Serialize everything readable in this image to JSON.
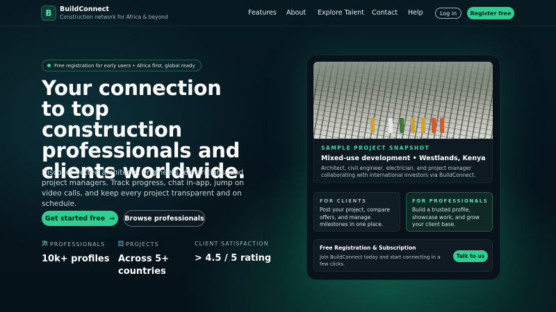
{
  "brand": {
    "logo_letter": "B",
    "name": "BuildConnect",
    "tagline": "Construction network for Africa & beyond"
  },
  "nav": {
    "links": [
      "Features",
      "About",
      "Explore Talent",
      "Contact",
      "Help"
    ],
    "login": "Log in",
    "register": "Register free"
  },
  "hero": {
    "badge": "Free registration for early users • Africa first, global ready",
    "headline": "Your connection to top construction professionals and clients worldwide.",
    "subtext": "Discover vetted architects, engineers, electricians, and project managers. Track progress, chat in-app, jump on video calls, and keep every project transparent and on schedule.",
    "cta_primary": "Get started free",
    "cta_primary_arrow": "→",
    "cta_secondary": "Browse professionals"
  },
  "stats": [
    {
      "label": "PROFESSIONALS",
      "value": "10k+ profiles",
      "icon": "users-icon"
    },
    {
      "label": "PROJECTS",
      "value": "Across 5+ countries",
      "icon": "building-icon"
    },
    {
      "label": "CLIENT SATISFACTION",
      "value": "> 4.5 / 5 rating",
      "icon": ""
    }
  ],
  "snapshot": {
    "kicker": "SAMPLE PROJECT SNAPSHOT",
    "title": "Mixed-use development • Westlands, Kenya",
    "description": "Architect, civil engineer, electrician, and project manager collaborating with international investors via BuildConnect."
  },
  "cards": {
    "clients": {
      "kicker": "FOR CLIENTS",
      "text": "Post your project, compare offers, and manage milestones in one place."
    },
    "professionals": {
      "kicker": "FOR PROFESSIONALS",
      "text": "Build a trusted profile, showcase work, and grow your client base."
    }
  },
  "subscription": {
    "title": "Free Registration & Subscription",
    "description": "Join BuildConnect today and start connecting in a few clicks.",
    "cta": "Talk to us"
  },
  "colors": {
    "accent": "#2fcf94",
    "background": "#06141c",
    "kicker": "#3fd79e"
  }
}
